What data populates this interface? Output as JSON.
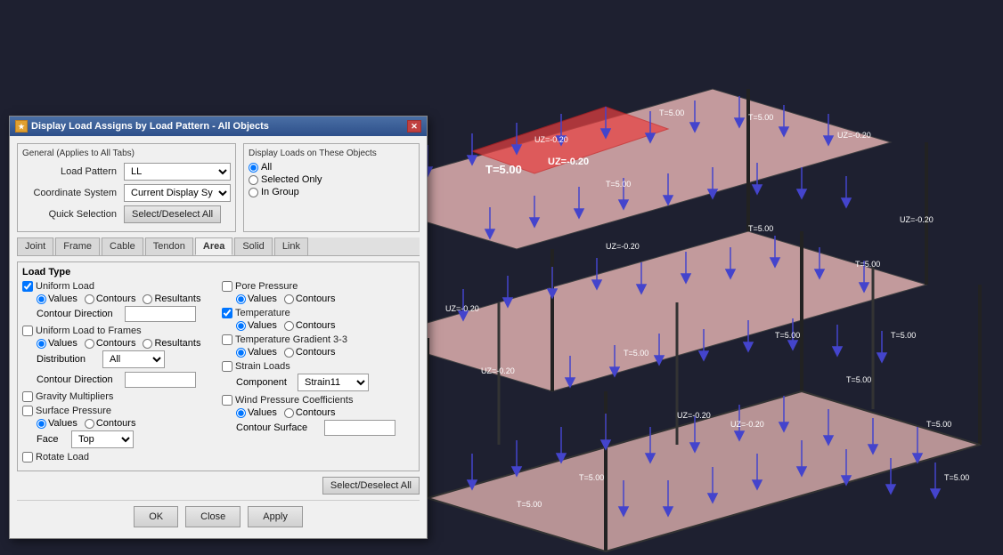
{
  "visualization": {
    "label": "Structural 3D view with load assignments"
  },
  "dialog": {
    "title": "Display Load Assigns by Load Pattern - All Objects",
    "icon": "★",
    "general_section": {
      "label": "General  (Applies to All Tabs)",
      "load_pattern_label": "Load Pattern",
      "load_pattern_value": "LL",
      "coordinate_system_label": "Coordinate System",
      "coordinate_system_value": "Current Display System",
      "quick_selection_label": "Quick Selection",
      "select_deselect_all_btn": "Select/Deselect All"
    },
    "display_on": {
      "title": "Display Loads on These Objects",
      "all_label": "All",
      "selected_only_label": "Selected Only",
      "in_group_label": "In Group"
    },
    "tabs": [
      {
        "label": "Joint"
      },
      {
        "label": "Frame"
      },
      {
        "label": "Cable"
      },
      {
        "label": "Tendon"
      },
      {
        "label": "Area",
        "active": true
      },
      {
        "label": "Solid"
      },
      {
        "label": "Link"
      }
    ],
    "load_type": {
      "title": "Load Type",
      "uniform_load": {
        "label": "Uniform Load",
        "checked": true,
        "values_label": "Values",
        "contours_label": "Contours",
        "resultants_label": "Resultants",
        "contour_direction_label": "Contour Direction"
      },
      "pore_pressure": {
        "label": "Pore Pressure",
        "checked": false,
        "values_label": "Values",
        "contours_label": "Contours"
      },
      "temperature": {
        "label": "Temperature",
        "checked": true,
        "values_label": "Values",
        "contours_label": "Contours"
      },
      "uniform_load_frames": {
        "label": "Uniform Load to Frames",
        "checked": false,
        "values_label": "Values",
        "contours_label": "Contours",
        "resultants_label": "Resultants",
        "distribution_label": "Distribution",
        "distribution_value": "All"
      },
      "temperature_gradient": {
        "label": "Temperature Gradient 3-3",
        "checked": false,
        "values_label": "Values",
        "contours_label": "Contours"
      },
      "strain_loads": {
        "label": "Strain Loads",
        "checked": false,
        "component_label": "Component",
        "component_value": "Strain11"
      },
      "gravity_multipliers": {
        "label": "Gravity Multipliers",
        "checked": false
      },
      "wind_pressure": {
        "label": "Wind Pressure Coefficients",
        "checked": false,
        "values_label": "Values",
        "contours_label": "Contours",
        "contour_surface_label": "Contour Surface"
      },
      "surface_pressure": {
        "label": "Surface Pressure",
        "checked": false,
        "values_label": "Values",
        "contours_label": "Contours",
        "face_label": "Face",
        "face_value": "Top"
      },
      "rotate_load": {
        "label": "Rotate Load",
        "checked": false
      }
    },
    "bottom_select_btn": "Select/Deselect All",
    "buttons": {
      "ok": "OK",
      "close": "Close",
      "apply": "Apply"
    }
  }
}
